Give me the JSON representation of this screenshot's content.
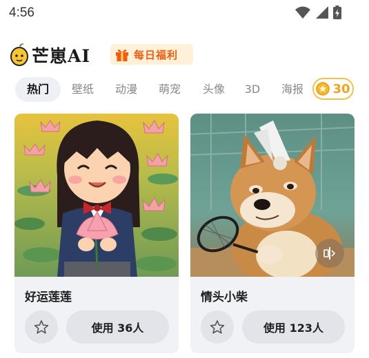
{
  "status_bar": {
    "time": "4:56",
    "icons": [
      "wifi-icon",
      "signal-icon",
      "battery-charging-icon"
    ]
  },
  "header": {
    "app_name": "芒崽AI",
    "logo_icon": "mango-mascot-icon",
    "bonus_badge": {
      "label": "每日福利",
      "icon": "gift-icon"
    }
  },
  "tabs": {
    "items": [
      {
        "label": "热门",
        "active": true
      },
      {
        "label": "壁纸",
        "active": false
      },
      {
        "label": "动漫",
        "active": false
      },
      {
        "label": "萌宠",
        "active": false
      },
      {
        "label": "头像",
        "active": false
      },
      {
        "label": "3D",
        "active": false
      },
      {
        "label": "海报",
        "active": false
      }
    ],
    "coins": {
      "icon": "coin-icon",
      "count": "30"
    }
  },
  "cards": [
    {
      "title": "好运莲莲",
      "use_label": "使用 36人",
      "image": "cartoon-girl-holding-lotus"
    },
    {
      "title": "情头小柴",
      "use_label": "使用 123人",
      "image": "shiba-dog-badminton",
      "overlay_icon": "compare-slider-icon"
    }
  ],
  "colors": {
    "accent_orange": "#f25c0c",
    "coin_gold": "#f2a31c",
    "tab_active_bg": "#eef0f5",
    "card_bg": "#f1f2f6",
    "button_bg": "#e3e4e9"
  }
}
